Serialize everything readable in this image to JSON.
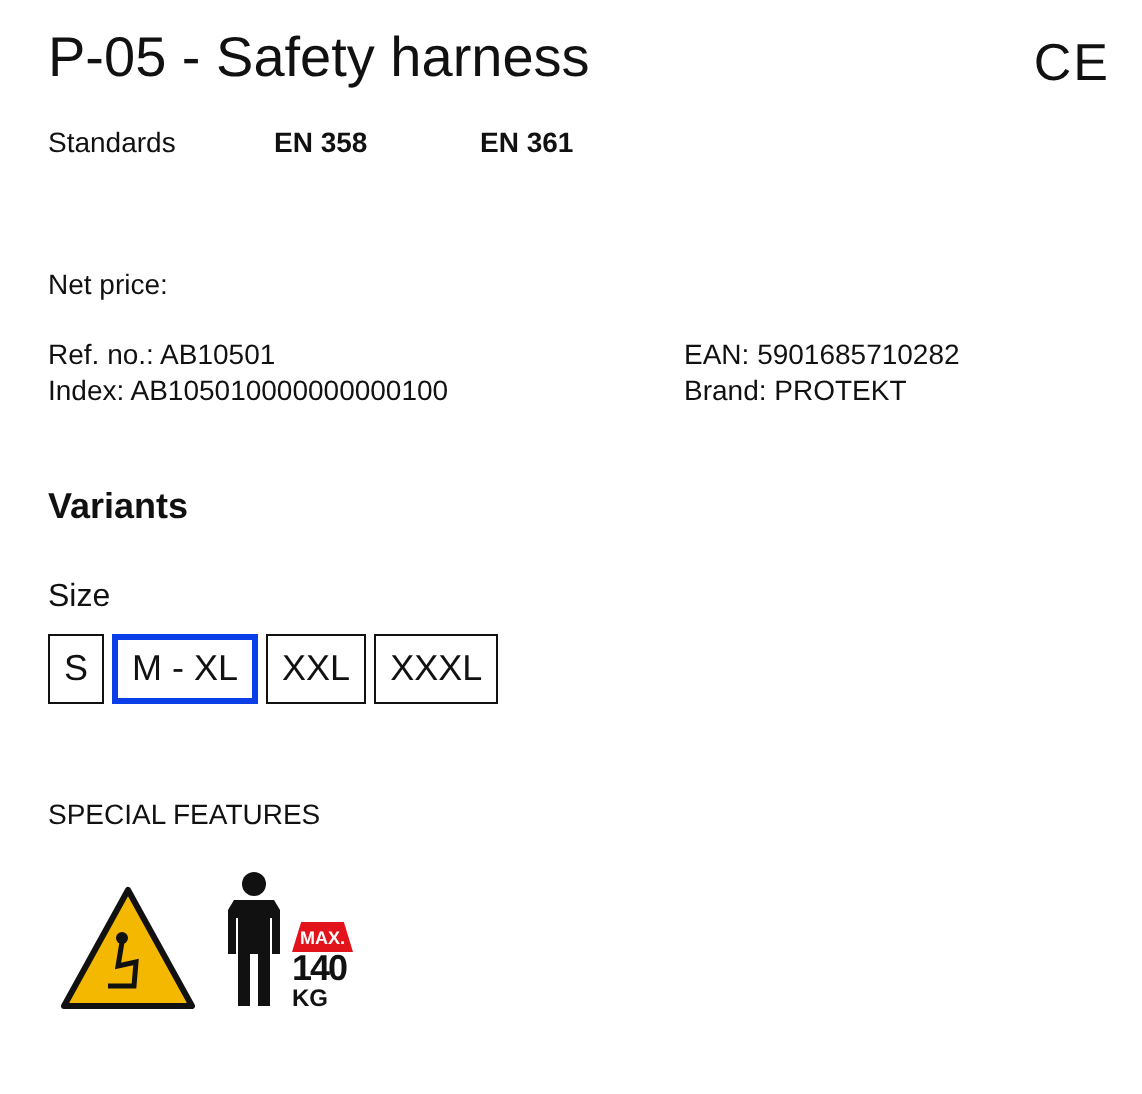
{
  "title": "P-05 - Safety harness",
  "mark": "CE",
  "standards": {
    "label": "Standards",
    "items": [
      "EN 358",
      "EN 361"
    ]
  },
  "net_price": {
    "label": "Net price:"
  },
  "details_left": [
    "Ref. no.: AB10501",
    "Index: AB105010000000000100"
  ],
  "details_right": [
    "EAN: 5901685710282",
    "Brand: PROTEKT"
  ],
  "variants": {
    "heading": "Variants",
    "size_label": "Size",
    "sizes": [
      {
        "label": "S",
        "selected": false
      },
      {
        "label": "M - XL",
        "selected": true
      },
      {
        "label": "XXL",
        "selected": false
      },
      {
        "label": "XXXL",
        "selected": false
      }
    ]
  },
  "features": {
    "heading": "SPECIAL FEATURES",
    "items": [
      {
        "kind": "electric_hazard"
      },
      {
        "kind": "max_load",
        "max": "MAX.",
        "load": "140",
        "unit": "KG"
      }
    ]
  }
}
